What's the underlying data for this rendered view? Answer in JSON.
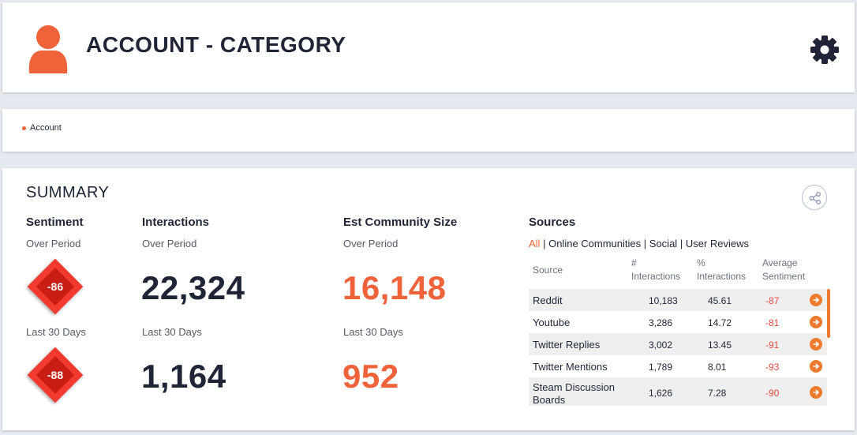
{
  "header": {
    "title": "ACCOUNT - CATEGORY",
    "avatar_icon": "user-icon",
    "settings_icon": "gear-icon"
  },
  "breadcrumb": {
    "label": "Account"
  },
  "summary": {
    "title": "SUMMARY",
    "share_icon": "share-icon",
    "sentiment": {
      "heading": "Sentiment",
      "period_label": "Over Period",
      "period_value": "-86",
      "last30_label": "Last 30 Days",
      "last30_value": "-88"
    },
    "interactions": {
      "heading": "Interactions",
      "period_label": "Over Period",
      "period_value": "22,324",
      "last30_label": "Last 30 Days",
      "last30_value": "1,164"
    },
    "community": {
      "heading": "Est Community Size",
      "period_label": "Over Period",
      "period_value": "16,148",
      "last30_label": "Last 30 Days",
      "last30_value": "952"
    },
    "sources": {
      "heading": "Sources",
      "filters": {
        "all": "All",
        "sep": "|",
        "online": "Online Communities",
        "social": "Social",
        "reviews": "User Reviews",
        "active": "All"
      },
      "columns": {
        "source": "Source",
        "interactions_1": "#",
        "interactions_2": "Interactions",
        "pct_1": "%",
        "pct_2": "Interactions",
        "sentiment_1": "Average",
        "sentiment_2": "Sentiment"
      },
      "rows": [
        {
          "source": "Reddit",
          "interactions": "10,183",
          "pct": "45.61",
          "sentiment": "-87"
        },
        {
          "source": "Youtube",
          "interactions": "3,286",
          "pct": "14.72",
          "sentiment": "-81"
        },
        {
          "source": "Twitter Replies",
          "interactions": "3,002",
          "pct": "13.45",
          "sentiment": "-91"
        },
        {
          "source": "Twitter Mentions",
          "interactions": "1,789",
          "pct": "8.01",
          "sentiment": "-93"
        },
        {
          "source": "Steam Discussion Boards",
          "interactions": "1,626",
          "pct": "7.28",
          "sentiment": "-90"
        }
      ]
    }
  },
  "colors": {
    "accent": "#f0633a",
    "dark": "#1f2537",
    "sentiment_red": "#f23a2e",
    "arrow_orange": "#ee7a2d"
  }
}
